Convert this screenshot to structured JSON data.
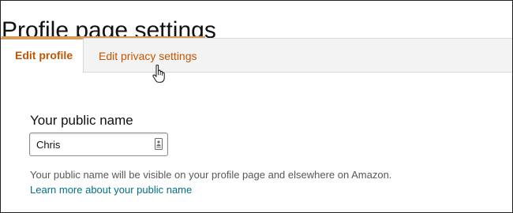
{
  "page": {
    "title": "Profile page settings"
  },
  "tabs": [
    {
      "label": "Edit profile",
      "active": true
    },
    {
      "label": "Edit privacy settings",
      "active": false
    }
  ],
  "public_name": {
    "heading": "Your public name",
    "value": "Chris",
    "field_icon": "contact-card-icon",
    "helper": "Your public name will be visible on your profile page and elsewhere on Amazon.",
    "learn_more": "Learn more about your public name"
  },
  "pointer": {
    "icon": "hand-pointer-icon"
  },
  "colors": {
    "tab_text": "#c45500",
    "accent_underline": "#d89a5e",
    "link": "#007185",
    "helper_text": "#565959",
    "tabbar_bg": "#f3f3f3"
  }
}
